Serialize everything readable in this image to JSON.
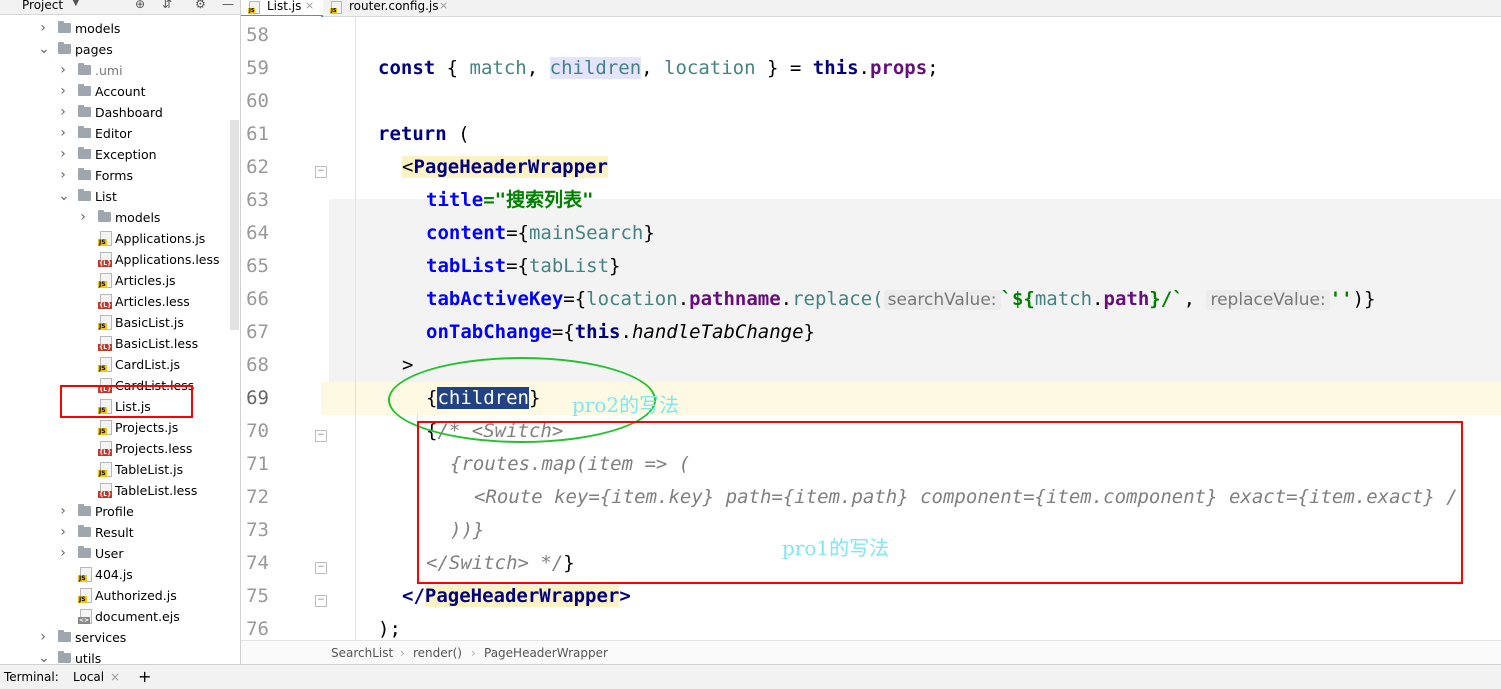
{
  "project_panel": {
    "title": "Project",
    "header_icons": [
      "crosshair-icon",
      "collapse-icon",
      "gear-icon",
      "hide-icon"
    ],
    "tree": [
      {
        "label": "models",
        "type": "folder",
        "expanded": false
      },
      {
        "label": "pages",
        "type": "folder",
        "expanded": true
      },
      {
        "label": ".umi",
        "type": "folder",
        "expanded": false
      },
      {
        "label": "Account",
        "type": "folder",
        "expanded": false
      },
      {
        "label": "Dashboard",
        "type": "folder",
        "expanded": false
      },
      {
        "label": "Editor",
        "type": "folder",
        "expanded": false
      },
      {
        "label": "Exception",
        "type": "folder",
        "expanded": false
      },
      {
        "label": "Forms",
        "type": "folder",
        "expanded": false
      },
      {
        "label": "List",
        "type": "folder",
        "expanded": true
      },
      {
        "label": "models",
        "type": "folder",
        "expanded": false
      },
      {
        "label": "Applications.js",
        "type": "js"
      },
      {
        "label": "Applications.less",
        "type": "less"
      },
      {
        "label": "Articles.js",
        "type": "js"
      },
      {
        "label": "Articles.less",
        "type": "less"
      },
      {
        "label": "BasicList.js",
        "type": "js"
      },
      {
        "label": "BasicList.less",
        "type": "less"
      },
      {
        "label": "CardList.js",
        "type": "js"
      },
      {
        "label": "CardList.less",
        "type": "less"
      },
      {
        "label": "List.js",
        "type": "js"
      },
      {
        "label": "Projects.js",
        "type": "js"
      },
      {
        "label": "Projects.less",
        "type": "less"
      },
      {
        "label": "TableList.js",
        "type": "js"
      },
      {
        "label": "TableList.less",
        "type": "less"
      },
      {
        "label": "Profile",
        "type": "folder",
        "expanded": false
      },
      {
        "label": "Result",
        "type": "folder",
        "expanded": false
      },
      {
        "label": "User",
        "type": "folder",
        "expanded": false
      },
      {
        "label": "404.js",
        "type": "js"
      },
      {
        "label": "Authorized.js",
        "type": "js"
      },
      {
        "label": "document.ejs",
        "type": "ejs"
      },
      {
        "label": "services",
        "type": "folder",
        "expanded": false
      },
      {
        "label": "utils",
        "type": "folder",
        "expanded": true
      }
    ]
  },
  "tabs": [
    {
      "label": "List.js",
      "active": true
    },
    {
      "label": "router.config.js",
      "active": false
    }
  ],
  "editor": {
    "line_numbers": [
      "58",
      "59",
      "60",
      "61",
      "62",
      "63",
      "64",
      "65",
      "66",
      "67",
      "68",
      "69",
      "70",
      "71",
      "72",
      "73",
      "74",
      "75",
      "76"
    ],
    "current_line": "69"
  },
  "code": {
    "l59": {
      "const": "const",
      "o1": " { ",
      "match": "match",
      "c1": ", ",
      "children": "children",
      "c2": ", ",
      "location": "location",
      "o2": " } = ",
      "this": "this",
      "dot": ".",
      "props": "props",
      "end": ";"
    },
    "l61": {
      "return": "return",
      "paren": " ("
    },
    "l62": {
      "lt": "<",
      "tag": "PageHeaderWrapper"
    },
    "l63": {
      "attr": "title",
      "eq": "=",
      "val": "\"搜索列表\""
    },
    "l64": {
      "attr": "content",
      "eq": "={",
      "id": "mainSearch",
      "end": "}"
    },
    "l65": {
      "attr": "tabList",
      "eq": "={",
      "id": "tabList",
      "end": "}"
    },
    "l66": {
      "attr": "tabActiveKey",
      "eq": "={",
      "location": "location",
      "d1": ".",
      "pathname": "pathname",
      "d2": ".",
      "replace": "replace(",
      "hint1": "searchValue:",
      "tpl1": "`${",
      "match": "match",
      "d3": ".",
      "path": "path",
      "tpl2": "}/`",
      "comma": ", ",
      "hint2": "replaceValue:",
      "str": "''",
      "end": ")}"
    },
    "l67": {
      "attr": "onTabChange",
      "eq": "={",
      "this": "this",
      "dot": ".",
      "method": "handleTabChange",
      "end": "}"
    },
    "l68": {
      "gt": ">"
    },
    "l69": {
      "open": "{",
      "sel": "children",
      "close": "}"
    },
    "l70": {
      "open": "{",
      "cm": "/* <Switch>"
    },
    "l71": {
      "cm": "{routes.map(item => ("
    },
    "l72": {
      "cm": "<Route key={item.key} path={item.path} component={item.component} exact={item.exact} /"
    },
    "l73": {
      "cm": "))}"
    },
    "l74": {
      "cm": "</Switch> */",
      "close": "}"
    },
    "l75": {
      "open": "</",
      "tag": "PageHeaderWrapper",
      "close": ">"
    },
    "l76": {
      "text": ");"
    }
  },
  "breadcrumb": [
    "SearchList",
    "render()",
    "PageHeaderWrapper"
  ],
  "bottom_bar": {
    "terminal_label": "Terminal:",
    "tab_label": "Local",
    "close": "×",
    "add": "+"
  },
  "annotations": {
    "pro2_text": "pro2的写法",
    "pro1_text": "pro1的写法",
    "rect_color": "#ff0000",
    "ellipse_color": "#22c22c",
    "text_color": "#7fe7f0"
  },
  "colors": {
    "keyword": "#000080",
    "string": "#008000",
    "comment": "#808080",
    "identifier": "#458383",
    "property": "#660e7a",
    "selection": "#214283",
    "current_line": "#fdf9e2"
  }
}
